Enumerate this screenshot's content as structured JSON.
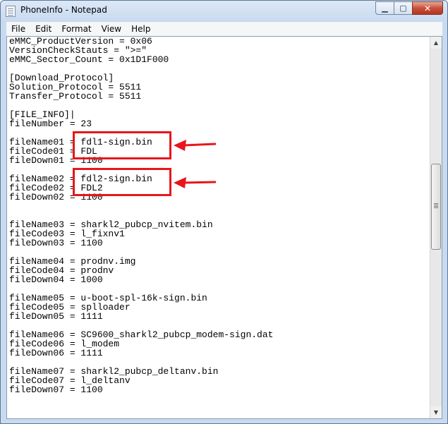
{
  "window": {
    "title": "PhoneInfo - Notepad"
  },
  "menu": [
    "File",
    "Edit",
    "Format",
    "View",
    "Help"
  ],
  "editor_lines": [
    "eMMC_ProductVersion = 0x06",
    "VersionCheckStauts = \">=\"",
    "eMMC_Sector_Count = 0x1D1F000",
    "",
    "[Download_Protocol]",
    "Solution_Protocol = 5511",
    "Transfer_Protocol = 5511",
    "",
    "[FILE_INFO]|",
    "fileNumber = 23",
    "",
    "fileName01 = fdl1-sign.bin",
    "fileCode01 = FDL",
    "fileDown01 = 1100",
    "",
    "fileName02 = fdl2-sign.bin",
    "fileCode02 = FDL2",
    "fileDown02 = 1100",
    "",
    "",
    "fileName03 = sharkl2_pubcp_nvitem.bin",
    "fileCode03 = l_fixnv1",
    "fileDown03 = 1100",
    "",
    "fileName04 = prodnv.img",
    "fileCode04 = prodnv",
    "fileDown04 = 1000",
    "",
    "fileName05 = u-boot-spl-16k-sign.bin",
    "fileCode05 = splloader",
    "fileDown05 = 1111",
    "",
    "fileName06 = SC9600_sharkl2_pubcp_modem-sign.dat",
    "fileCode06 = l_modem",
    "fileDown06 = 1111",
    "",
    "fileName07 = sharkl2_pubcp_deltanv.bin",
    "fileCode07 = l_deltanv",
    "fileDown07 = 1100"
  ],
  "colors": {
    "annotation": "#e8161c"
  }
}
